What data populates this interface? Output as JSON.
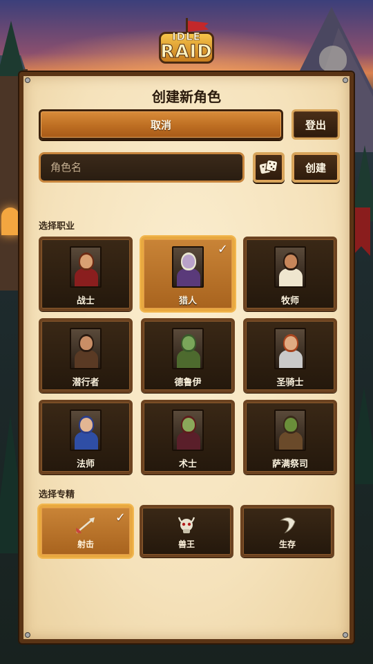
{
  "logo": {
    "top": "IDLE",
    "main": "RAID"
  },
  "title": "创建新角色",
  "buttons": {
    "cancel": "取消",
    "logout": "登出",
    "create": "创建",
    "dice_icon": "dice-icon"
  },
  "name_input": {
    "placeholder": "角色名",
    "value": ""
  },
  "class_section_label": "选择职业",
  "classes": [
    {
      "label": "战士",
      "selected": false,
      "hair": "#6a2a14",
      "skin": "#d9a072",
      "armor": "#8a1e1e"
    },
    {
      "label": "猎人",
      "selected": true,
      "hair": "#e8e6d0",
      "skin": "#b9a2c9",
      "armor": "#5a3a7a"
    },
    {
      "label": "牧师",
      "selected": false,
      "hair": "#2a1a10",
      "skin": "#c7865a",
      "armor": "#efe6cf"
    },
    {
      "label": "潜行者",
      "selected": false,
      "hair": "#2a1a10",
      "skin": "#c98e66",
      "armor": "#5a3a24"
    },
    {
      "label": "德鲁伊",
      "selected": false,
      "hair": "#3a5a2a",
      "skin": "#7aa65a",
      "armor": "#4d6a2e"
    },
    {
      "label": "圣骑士",
      "selected": false,
      "hair": "#a8441e",
      "skin": "#e0ab82",
      "armor": "#c9c9c9"
    },
    {
      "label": "法师",
      "selected": false,
      "hair": "#2c3e8a",
      "skin": "#e3b693",
      "armor": "#2f4ea5"
    },
    {
      "label": "术士",
      "selected": false,
      "hair": "#5e1c1c",
      "skin": "#8aa85a",
      "armor": "#5a1f2a"
    },
    {
      "label": "萨满祭司",
      "selected": false,
      "hair": "#3a2a1a",
      "skin": "#6a8f3a",
      "armor": "#6a4a2a"
    }
  ],
  "spec_section_label": "选择专精",
  "specs": [
    {
      "label": "射击",
      "selected": true,
      "icon": "arrow-icon"
    },
    {
      "label": "兽王",
      "selected": false,
      "icon": "beast-skull-icon"
    },
    {
      "label": "生存",
      "selected": false,
      "icon": "claw-icon"
    }
  ],
  "check_glyph": "✓"
}
